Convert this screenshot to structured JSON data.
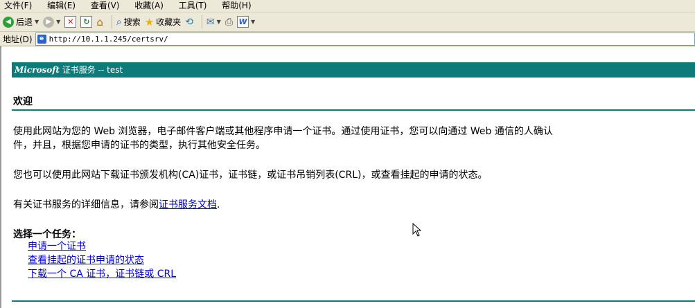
{
  "menu": {
    "items": [
      "文件(F)",
      "编辑(E)",
      "查看(V)",
      "收藏(A)",
      "工具(T)",
      "帮助(H)"
    ]
  },
  "toolbar": {
    "back_label": "后退",
    "search_label": "搜索",
    "favorites_label": "收藏夹"
  },
  "address": {
    "label": "地址(D)",
    "url": "http://10.1.1.245/certsrv/"
  },
  "banner": {
    "brand": "Microsoft",
    "service": "证书服务",
    "separator": "--",
    "ca_name": "test"
  },
  "page": {
    "welcome": "欢迎",
    "para1_line1": "使用此网站为您的 Web 浏览器，电子邮件客户端或其他程序申请一个证书。通过使用证书，您可以向通过 Web 通信的人确认",
    "para1_line2": "件，并且，根据您申请的证书的类型，执行其他安全任务。",
    "para2": "您也可以使用此网站下载证书颁发机构(CA)证书，证书链，或证书吊销列表(CRL)，或查看挂起的申请的状态。",
    "para3_prefix": "有关证书服务的详细信息，请参阅",
    "para3_link": "证书服务文档",
    "para3_suffix": ".",
    "tasks_heading": "选择一个任务：",
    "tasks": [
      "申请一个证书",
      "查看挂起的证书申请的状态",
      "下载一个 CA 证书，证书链或 CRL"
    ]
  },
  "colors": {
    "accent": "#0f7a7a",
    "link": "#0000cc",
    "chrome": "#ece9d8"
  },
  "icons": [
    "back-arrow-icon",
    "forward-arrow-icon",
    "stop-icon",
    "refresh-icon",
    "home-icon",
    "search-icon",
    "favorites-star-icon",
    "history-icon",
    "mail-icon",
    "print-icon",
    "word-edit-icon",
    "page-icon",
    "mouse-cursor-icon"
  ]
}
